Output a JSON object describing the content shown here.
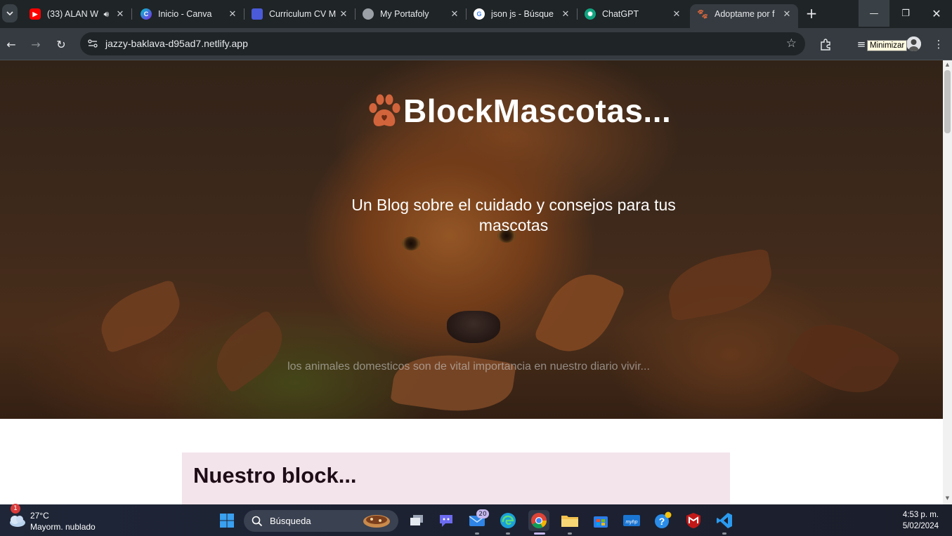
{
  "browser": {
    "tabs": [
      {
        "title": "(33) ALAN W",
        "favicon": "youtube-icon",
        "color": "#ff0000",
        "audio": true
      },
      {
        "title": "Inicio - Canva",
        "favicon": "canva-icon",
        "color": "#7d2ae8"
      },
      {
        "title": "Curriculum CV M",
        "favicon": "cv-icon",
        "color": "#4a5ad9"
      },
      {
        "title": "My Portafoly",
        "favicon": "globe-icon",
        "color": "#9aa0a6"
      },
      {
        "title": "json js - Búsque",
        "favicon": "google-icon",
        "color": "#ffffff"
      },
      {
        "title": "ChatGPT",
        "favicon": "chatgpt-icon",
        "color": "#10a37f"
      },
      {
        "title": "Adoptame por f",
        "favicon": "paw-icon",
        "color": "#d2643c",
        "active": true
      }
    ],
    "url": "jazzy-baklava-d95ad7.netlify.app",
    "tooltip": "Minimizar"
  },
  "page": {
    "brand_title": "BlockMascotas...",
    "subtitle": "Un Blog sobre el cuidado y consejos para tus mascotas",
    "caption": "los animales domesticos son de vital importancia en nuestro diario vivir...",
    "section_title": "Nuestro block...",
    "accent_color": "#d2643c",
    "card_color": "#f3e3ea"
  },
  "taskbar": {
    "weather_temp": "27°C",
    "weather_desc": "Mayorm. nublado",
    "weather_badge": "1",
    "search_label": "Búsqueda",
    "mail_badge": "20",
    "time": "4:53 p. m.",
    "date": "5/02/2024"
  }
}
